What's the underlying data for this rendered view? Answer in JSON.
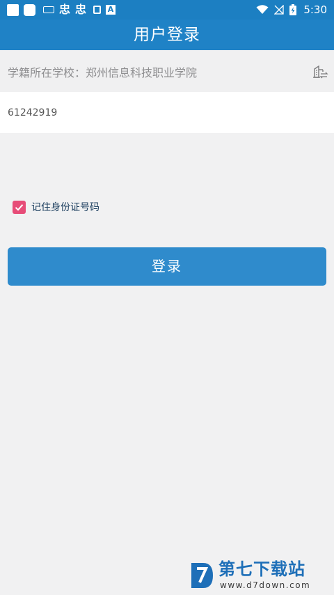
{
  "status_bar": {
    "time": "5:30",
    "notification_glyph": "忠",
    "badge_letter": "A",
    "colors": {
      "background": "#1c7fc2"
    }
  },
  "app_bar": {
    "title": "用户登录",
    "color": "#1f82c6"
  },
  "form": {
    "school_text": "学籍所在学校：郑州信息科技职业学院",
    "school_icon": "building-switch-icon",
    "id_value": "61242919",
    "remember_label": "记住身份证号码",
    "remember_checked": true,
    "checkbox_color": "#e74c78"
  },
  "login_button": {
    "label": "登录",
    "color": "#2f8bcc"
  },
  "watermark": {
    "title": "第七下载站",
    "url": "www.d7down.com"
  }
}
